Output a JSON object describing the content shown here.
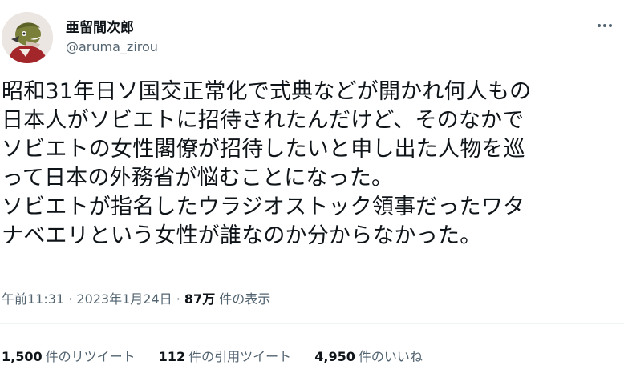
{
  "author": {
    "display_name": "亜留間次郎",
    "handle": "@aruma_zirou",
    "avatar_icon": "cartoon-character-avatar"
  },
  "menu": {
    "icon": "more-options-icon"
  },
  "tweet": {
    "lines": [
      "昭和31年日ソ国交正常化で式典などが開かれ何人もの",
      "日本人がソビエトに招待されたんだけど、そのなかで",
      "ソビエトの女性閣僚が招待したいと申し出た人物を巡",
      "って日本の外務省が悩むことになった。",
      "ソビエトが指名したウラジオストック領事だったワタ",
      "ナベエリという女性が誰なのか分からなかった。"
    ]
  },
  "meta": {
    "time": "午前11:31",
    "sep1": " · ",
    "date": "2023年1月24日",
    "sep2": " · ",
    "views_count": "87万",
    "views_label": " 件の表示"
  },
  "stats": {
    "retweets": {
      "count": "1,500",
      "label": "件のリツイート"
    },
    "quotes": {
      "count": "112",
      "label": "件の引用ツイート"
    },
    "likes": {
      "count": "4,950",
      "label": "件のいいね"
    }
  },
  "colors": {
    "text_primary": "#0f1419",
    "text_secondary": "#536471",
    "divider": "#eff3f4"
  }
}
